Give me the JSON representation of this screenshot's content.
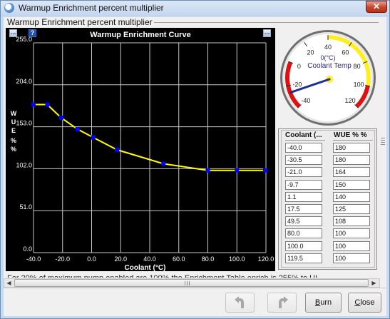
{
  "window": {
    "title": "Warmup Enrichment percent multiplier",
    "close_glyph": "✕"
  },
  "group": {
    "label": "Warmup Enrichment percent multiplier"
  },
  "toolbar": {
    "menu_left": "...",
    "help": "?",
    "menu_right": "..."
  },
  "chart_data": {
    "type": "line",
    "title": "Warmup Enrichment Curve",
    "xlabel": "Coolant (°C)",
    "ylabel": "W U E % %",
    "x": [
      -40.0,
      -30.5,
      -21.0,
      -9.7,
      1.1,
      17.5,
      49.5,
      80.0,
      100.0,
      119.5
    ],
    "y": [
      180,
      180,
      164,
      150,
      140,
      125,
      108,
      100,
      100,
      100
    ],
    "xlim": [
      -40,
      120
    ],
    "ylim": [
      0,
      255
    ],
    "xticks": [
      "-40.0",
      "-20.0",
      "0.0",
      "20.0",
      "40.0",
      "60.0",
      "80.0",
      "100.0",
      "120.0"
    ],
    "yticks": [
      "255.0",
      "204.0",
      "153.0",
      "102.0",
      "51.0",
      "0.0"
    ],
    "ytick_values": [
      255,
      204,
      153,
      102,
      51,
      0
    ],
    "xtick_values": [
      -40,
      -20,
      0,
      20,
      40,
      60,
      80,
      100,
      120
    ],
    "grid": true,
    "line_color": "#ffff00",
    "point_color": "#0000ff",
    "background": "#000000"
  },
  "gauge": {
    "label": "Coolant Temp",
    "value_text": "0(°C)",
    "value": -26,
    "min": -40,
    "max": 120,
    "tick_labels": [
      "-40",
      "-20",
      "0",
      "20",
      "40",
      "60",
      "80",
      "100",
      "120"
    ],
    "tick_values": [
      -40,
      -20,
      0,
      20,
      40,
      60,
      80,
      100,
      120
    ],
    "low_critical_range": [
      -40,
      0
    ],
    "warning_range_upper": [
      40,
      100
    ],
    "high_critical_range": [
      100,
      120
    ],
    "colors": {
      "critical": "#e01010",
      "warning": "#ffee22",
      "needle": "#1c2f8a"
    }
  },
  "table": {
    "headers": [
      "Coolant (...",
      "WUE % %"
    ],
    "coolant": [
      "-40.0",
      "-30.5",
      "-21.0",
      "-9.7",
      "1.1",
      "17.5",
      "49.5",
      "80.0",
      "100.0",
      "119.5"
    ],
    "wue": [
      "180",
      "180",
      "164",
      "150",
      "140",
      "125",
      "108",
      "100",
      "100",
      "100"
    ]
  },
  "info_text": "For 20% of maximum pump enabled are 100% the Enrichment Table enrich is 255% to UI",
  "buttons": {
    "burn_prefix": "",
    "burn_mnemonic": "B",
    "burn_rest": "urn",
    "close_mnemonic": "C",
    "close_rest": "lose"
  }
}
